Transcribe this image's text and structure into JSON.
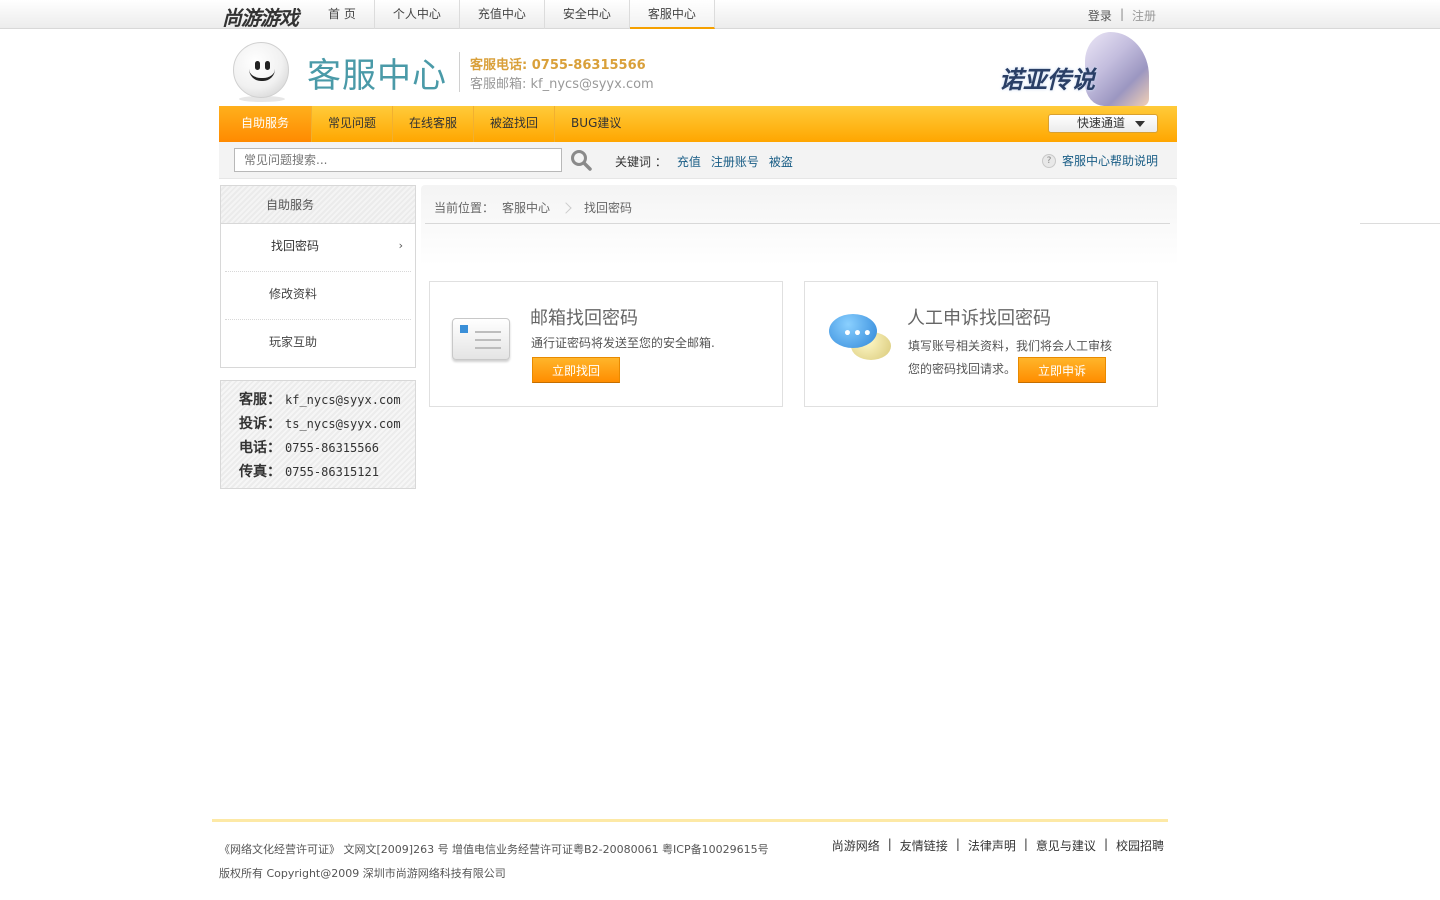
{
  "topbar": {
    "logo": "尚游游戏",
    "nav": [
      "首 页",
      "个人中心",
      "充值中心",
      "安全中心",
      "客服中心"
    ],
    "active_index": 4,
    "login": "登录",
    "sep": "|",
    "register": "注册"
  },
  "header": {
    "title": "客服中心",
    "phone": "客服电话: 0755-86315566",
    "email": "客服邮箱: kf_nycs@syyx.com",
    "game_logo": "诺亚传说"
  },
  "menu": {
    "items": [
      "自助服务",
      "常见问题",
      "在线客服",
      "被盗找回",
      "BUG建议"
    ],
    "active_index": 0,
    "quick": "快速通道"
  },
  "search": {
    "placeholder": "常见问题搜索...",
    "keywords_label": "关键词 ：",
    "keywords": [
      "充值",
      "注册账号",
      "被盗"
    ],
    "help": "客服中心帮助说明"
  },
  "sidebar": {
    "heading": "自助服务",
    "items": [
      "找回密码",
      "修改资料",
      "玩家互助"
    ],
    "chev": "›"
  },
  "contacts": [
    {
      "label": "客服：",
      "value": "kf_nycs@syyx.com"
    },
    {
      "label": "投诉：",
      "value": "ts_nycs@syyx.com"
    },
    {
      "label": "电话：",
      "value": "0755-86315566"
    },
    {
      "label": "传真：",
      "value": "0755-86315121"
    }
  ],
  "breadcrumb": {
    "label": "当前位置：",
    "home": "客服中心",
    "current": "找回密码"
  },
  "cards": [
    {
      "title": "邮箱找回密码",
      "desc": "通行证密码将发送至您的安全邮箱.",
      "button": "立即找回"
    },
    {
      "title": "人工申诉找回密码",
      "desc1": "填写账号相关资料，我们将会人工审核",
      "desc2": "您的密码找回请求。",
      "button": "立即申诉"
    }
  ],
  "footer": {
    "line1": "《网络文化经营许可证》 文网文[2009]263 号 增值电信业务经营许可证粤B2-20080061 粤ICP备10029615号",
    "line2": "版权所有 Copyright@2009 深圳市尚游网络科技有限公司",
    "links": [
      "尚游网络",
      "友情链接",
      "法律声明",
      "意见与建议",
      "校园招聘"
    ],
    "sep": "|"
  }
}
